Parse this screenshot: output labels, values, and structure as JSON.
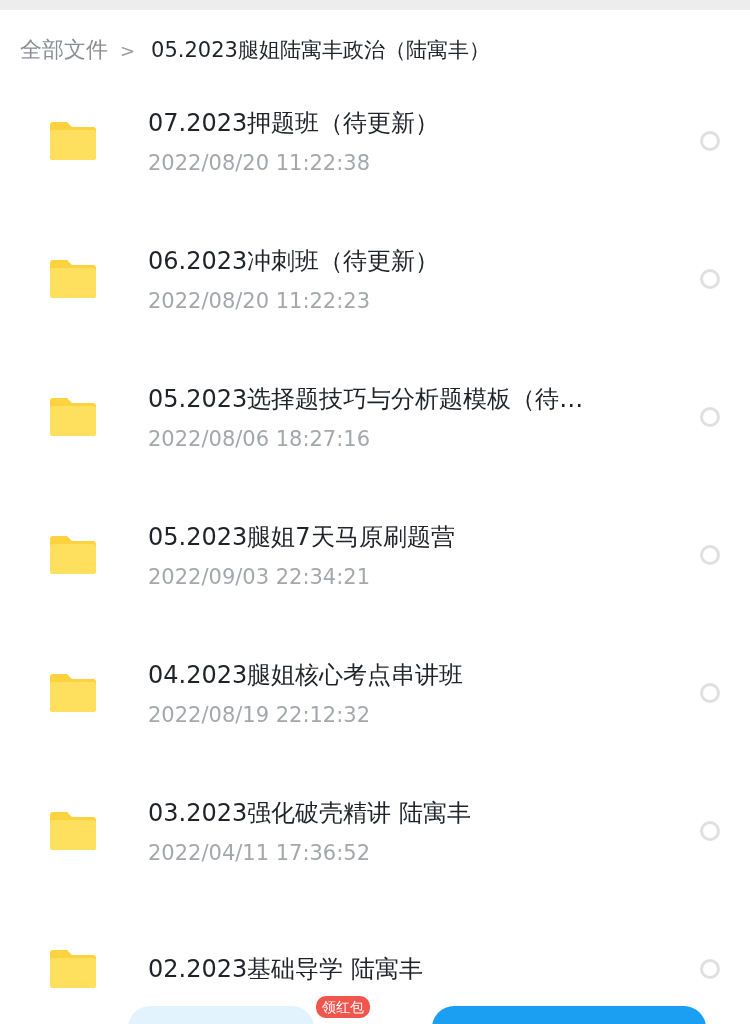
{
  "breadcrumb": {
    "root": "全部文件",
    "separator": ">",
    "current": "05.2023腿姐陆寓丰政治（陆寓丰）"
  },
  "files": [
    {
      "name": "07.2023押题班（待更新）",
      "date": "2022/08/20 11:22:38",
      "selected": false
    },
    {
      "name": "06.2023冲刺班（待更新）",
      "date": "2022/08/20 11:22:23",
      "selected": false
    },
    {
      "name": "05.2023选择题技巧与分析题模板（待…",
      "date": "2022/08/06 18:27:16",
      "selected": false
    },
    {
      "name": "05.2023腿姐7天马原刷题营",
      "date": "2022/09/03 22:34:21",
      "selected": false
    },
    {
      "name": "04.2023腿姐核心考点串讲班",
      "date": "2022/08/19 22:12:32",
      "selected": false
    },
    {
      "name": "03.2023强化破壳精讲 陆寓丰",
      "date": "2022/04/11 17:36:52",
      "selected": false
    },
    {
      "name": "02.2023基础导学 陆寓丰",
      "selected": false
    }
  ],
  "bottom_badge": "领红包"
}
